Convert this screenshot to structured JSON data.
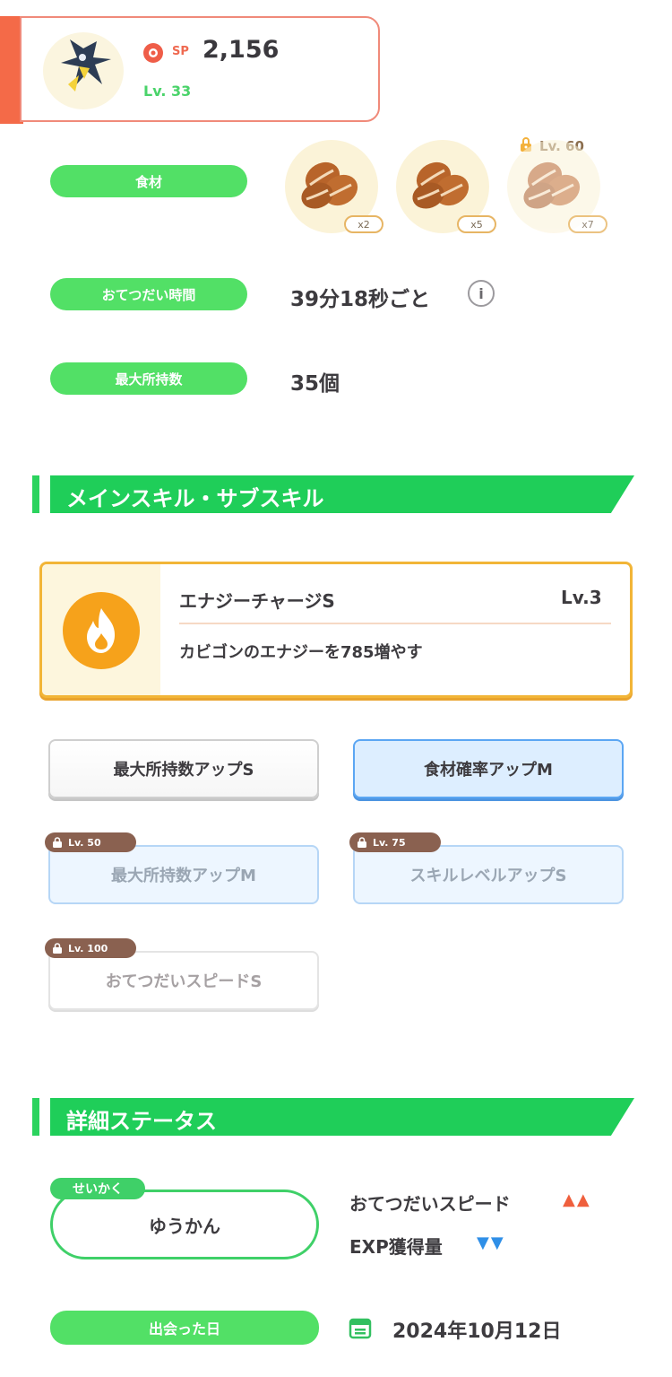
{
  "header": {
    "sp_label": "SP",
    "sp_value": "2,156",
    "level": "Lv. 33"
  },
  "ingredients": {
    "label": "食材",
    "items": [
      {
        "count": "x2",
        "locked": false
      },
      {
        "count": "x5",
        "locked": false
      },
      {
        "count": "x7",
        "locked": true,
        "lock_level": "Lv. 60"
      }
    ]
  },
  "help_time": {
    "label": "おてつだい時間",
    "value": "39分18秒ごと"
  },
  "max_carry": {
    "label": "最大所持数",
    "value": "35個"
  },
  "skills_section": {
    "title": "メインスキル・サブスキル"
  },
  "main_skill": {
    "name": "エナジーチャージS",
    "level": "Lv.3",
    "description": "カビゴンのエナジーを785増やす"
  },
  "sub_skills": [
    {
      "label": "最大所持数アップS",
      "state": "unlocked"
    },
    {
      "label": "食材確率アップM",
      "state": "unlocked-blue"
    },
    {
      "label": "最大所持数アップM",
      "state": "locked",
      "lock_level": "Lv. 50"
    },
    {
      "label": "スキルレベルアップS",
      "state": "locked",
      "lock_level": "Lv. 75"
    },
    {
      "label": "おてつだいスピードS",
      "state": "locked",
      "lock_level": "Lv. 100"
    }
  ],
  "detail_section": {
    "title": "詳細ステータス"
  },
  "nature": {
    "tag": "せいかく",
    "value": "ゆうかん",
    "up_label": "おてつだいスピード",
    "up_marks": "▲▲",
    "down_label": "EXP獲得量",
    "down_marks": "▼▼"
  },
  "met_date": {
    "label": "出会った日",
    "value": "2024年10月12日"
  },
  "colors": {
    "green": "#52e066",
    "accent_orange": "#f46a48",
    "skill_gold": "#f2b537",
    "blue": "#5ba6f3"
  }
}
